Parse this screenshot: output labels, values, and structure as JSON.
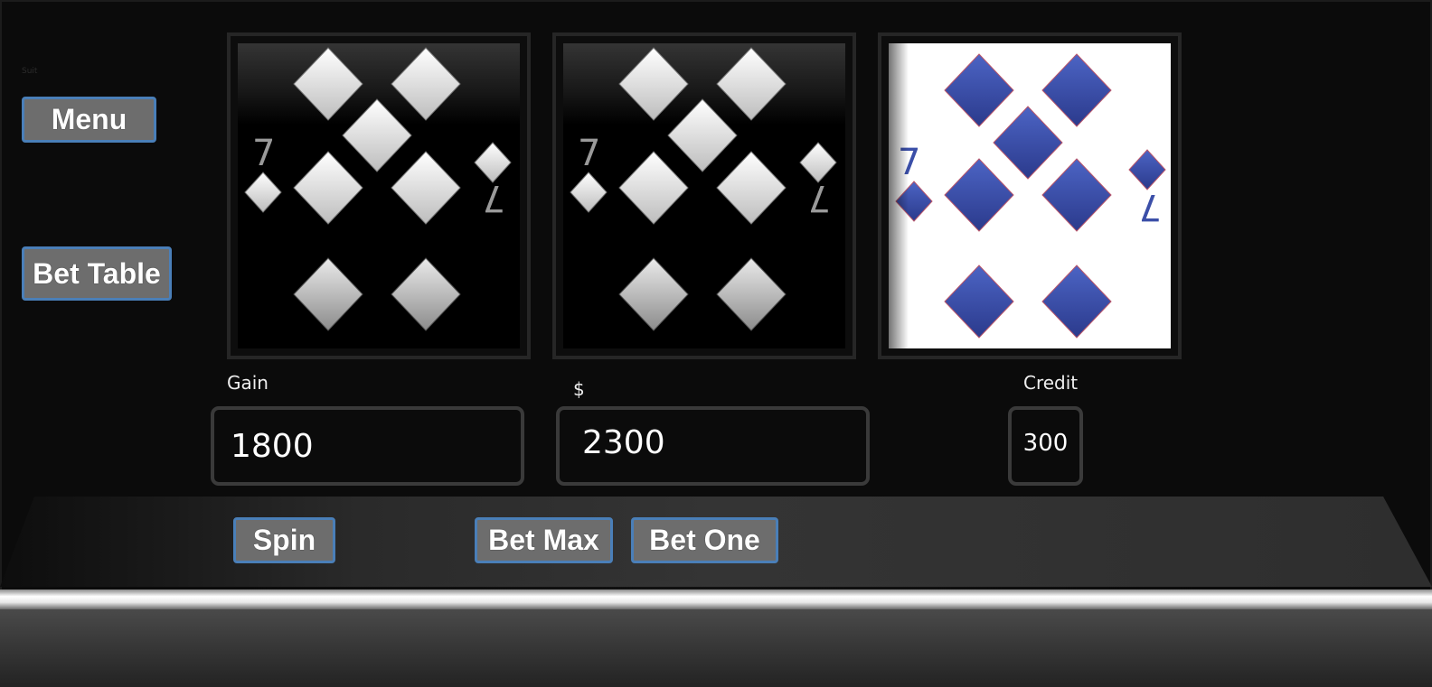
{
  "sidebar": {
    "tiny_text": "Suit",
    "menu_label": "Menu",
    "bet_table_label": "Bet Table"
  },
  "reels": [
    {
      "card": "7 of diamonds",
      "rank": "7",
      "style": "dark-blurred"
    },
    {
      "card": "7 of diamonds",
      "rank": "7",
      "style": "dark-blurred"
    },
    {
      "card": "7 of diamonds",
      "rank": "7",
      "style": "blue-on-white"
    }
  ],
  "fields": {
    "gain_label": "Gain",
    "gain_value": "1800",
    "money_label": "$",
    "money_value": "2300",
    "credit_label": "Credit",
    "credit_value": "300"
  },
  "controls": {
    "spin_label": "Spin",
    "bet_max_label": "Bet Max",
    "bet_one_label": "Bet One"
  },
  "colors": {
    "button_fill": "#6d6d6d",
    "button_border": "#4a7fb8",
    "diamond_blue": "#3b4fa8",
    "background": "#0b0b0b"
  }
}
